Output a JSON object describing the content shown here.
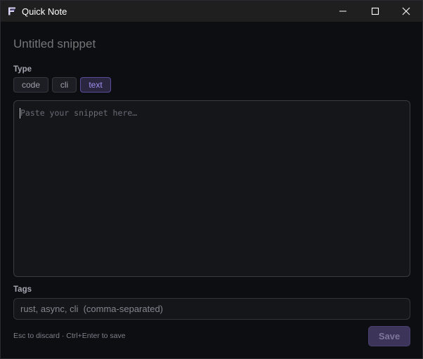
{
  "window": {
    "title": "Quick Note",
    "icon": "app-logo-icon",
    "controls": {
      "minimize_icon": "minimize-icon",
      "maximize_icon": "maximize-icon",
      "close_icon": "close-icon"
    }
  },
  "form": {
    "title_placeholder": "Untitled snippet",
    "title_value": "",
    "type_label": "Type",
    "type_options": [
      "code",
      "cli",
      "text"
    ],
    "type_selected": "text",
    "snippet_placeholder": "Paste your snippet here…",
    "snippet_value": "",
    "tags_label": "Tags",
    "tags_placeholder": "rust, async, cli  (comma-separated)",
    "tags_value": ""
  },
  "footer": {
    "hint": "Esc to discard · Ctrl+Enter to save",
    "save_label": "Save"
  },
  "colors": {
    "accent": "#a08ff0",
    "accent_bg": "#2a2640",
    "save_bg": "#3c3459",
    "window_bg": "#0d0e12",
    "titlebar_bg": "#1f1f1f"
  }
}
